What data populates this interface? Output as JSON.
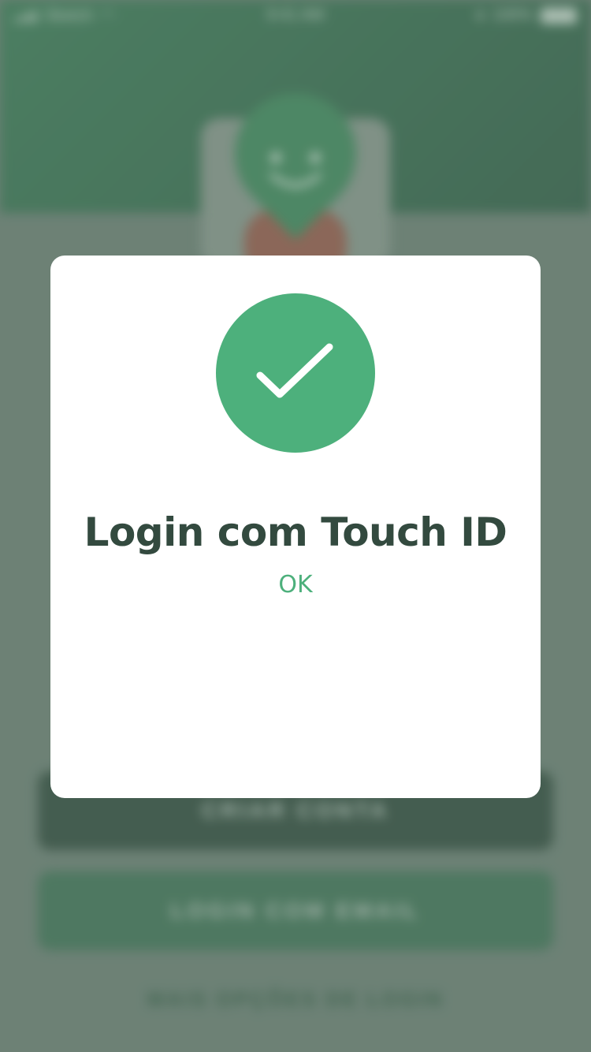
{
  "status_bar": {
    "carrier": "Sketch",
    "time": "9:41 AM",
    "battery": "100%",
    "icons": [
      "signal-icon",
      "wifi-icon",
      "bluetooth-icon",
      "battery-icon"
    ]
  },
  "background": {
    "create_account_label": "CRIAR CONTA",
    "email_login_label": "LOGIN COM EMAIL",
    "more_options_label": "MAIS OPÇÕES DE LOGIN"
  },
  "modal": {
    "icon": "checkmark-icon",
    "title": "Login com Touch ID",
    "ok_label": "OK"
  },
  "colors": {
    "accent": "#4db07c",
    "title_text": "#334a3f",
    "header_green": "#3a7d57",
    "overlay": "#6d8276"
  }
}
